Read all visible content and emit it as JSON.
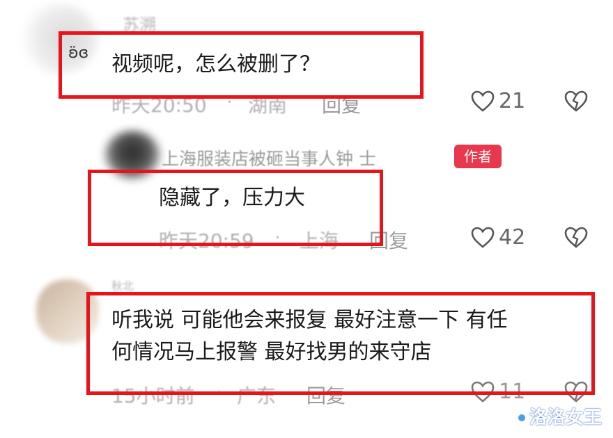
{
  "comments": [
    {
      "username": "苏溯",
      "text": "视频呢，怎么被删了？",
      "time": "昨天20:50",
      "separator": "·",
      "location": "湖南",
      "reply_label": "回复",
      "likes": "21",
      "avatar_mark": "ʚ̈ɞ"
    },
    {
      "username": "上海服装店被砸当事人钟  士",
      "author_badge": "作者",
      "text": "隐藏了，压力大",
      "time": "昨天20:59",
      "separator": "·",
      "location": "上海",
      "reply_label": "回复",
      "likes": "42"
    },
    {
      "username": "秋北",
      "text_line1": "听我说 可能他会来报复 最好注意一下 有任",
      "text_line2": "何情况马上报警 最好找男的来守店",
      "time": "15小时前",
      "separator": "·",
      "location": "广东",
      "reply_label": "回复",
      "likes": "11"
    }
  ],
  "watermark": "洛洛女王",
  "colors": {
    "highlight": "#e8141c",
    "badge": "#e8384d",
    "meta_text": "#b0b0b0",
    "icon": "#555555"
  },
  "icons": {
    "like": "heart-outline-icon",
    "dislike": "broken-heart-icon"
  }
}
